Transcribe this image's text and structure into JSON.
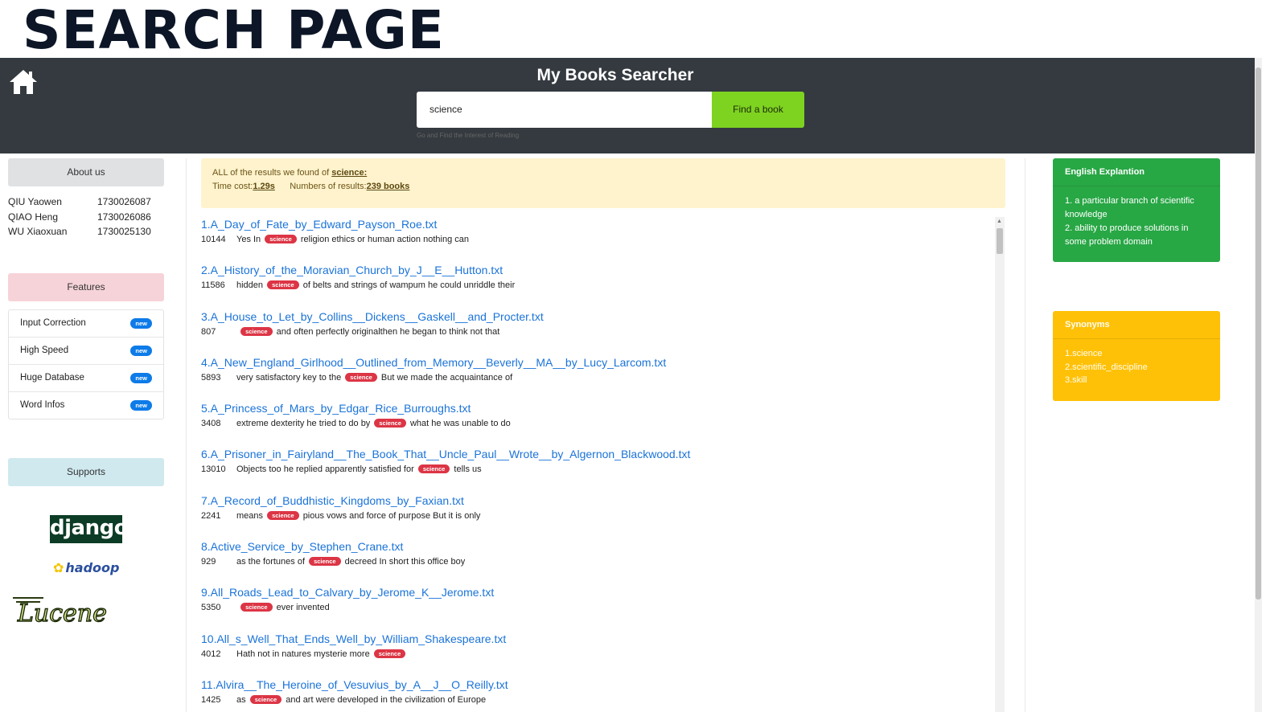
{
  "page_heading": "SEARCH PAGE",
  "header": {
    "app_title": "My Books Searcher",
    "search_value": "science",
    "find_button": "Find a book",
    "tagline": "Go and Find the Interest of Reading"
  },
  "sidebar": {
    "about_title": "About us",
    "members": [
      {
        "name": "QIU   Yaowen",
        "id": "1730026087"
      },
      {
        "name": "QIAO Heng",
        "id": "1730026086"
      },
      {
        "name": "WU    Xiaoxuan",
        "id": "1730025130"
      }
    ],
    "features_title": "Features",
    "features": [
      {
        "label": "Input Correction",
        "badge": "new"
      },
      {
        "label": "High  Speed",
        "badge": "new"
      },
      {
        "label": "Huge  Database",
        "badge": "new"
      },
      {
        "label": "Word  Infos",
        "badge": "new"
      }
    ],
    "supports_title": "Supports",
    "logos": {
      "django": "django",
      "hadoop": "hadoop",
      "lucene": "Lucene"
    }
  },
  "summary": {
    "prefix": "ALL of the results we found of",
    "query": "science:",
    "time_label": "Time cost:",
    "time_value": "1.29s",
    "count_label": "Numbers of results:",
    "count_value": "239 books"
  },
  "results": [
    {
      "title": "1.A_Day_of_Fate_by_Edward_Payson_Roe.txt",
      "count": "10144",
      "before": "Yes In",
      "keyword": "science",
      "after": "religion ethics or human action nothing can"
    },
    {
      "title": "2.A_History_of_the_Moravian_Church_by_J__E__Hutton.txt",
      "count": "11586",
      "before": "hidden",
      "keyword": "science",
      "after": "of belts and strings of wampum he could unriddle their"
    },
    {
      "title": "3.A_House_to_Let_by_Collins__Dickens__Gaskell__and_Procter.txt",
      "count": "807",
      "before": "",
      "keyword": "science",
      "after": "and often perfectly originalthen he began to think not that"
    },
    {
      "title": "4.A_New_England_Girlhood__Outlined_from_Memory__Beverly__MA__by_Lucy_Larcom.txt",
      "count": "5893",
      "before": "very satisfactory key to the",
      "keyword": "science",
      "after": "But we made the acquaintance of"
    },
    {
      "title": "5.A_Princess_of_Mars_by_Edgar_Rice_Burroughs.txt",
      "count": "3408",
      "before": "extreme dexterity he tried to do by",
      "keyword": "science",
      "after": "what he was unable to do"
    },
    {
      "title": "6.A_Prisoner_in_Fairyland__The_Book_That__Uncle_Paul__Wrote__by_Algernon_Blackwood.txt",
      "count": "13010",
      "before": "Objects too he replied apparently satisfied for",
      "keyword": "science",
      "after": "tells us"
    },
    {
      "title": "7.A_Record_of_Buddhistic_Kingdoms_by_Faxian.txt",
      "count": "2241",
      "before": "means",
      "keyword": "science",
      "after": "pious vows and force of purpose But it is only"
    },
    {
      "title": "8.Active_Service_by_Stephen_Crane.txt",
      "count": "929",
      "before": "as the fortunes of",
      "keyword": "science",
      "after": "decreed In short this office boy"
    },
    {
      "title": "9.All_Roads_Lead_to_Calvary_by_Jerome_K__Jerome.txt",
      "count": "5350",
      "before": "",
      "keyword": "science",
      "after": "ever invented"
    },
    {
      "title": "10.All_s_Well_That_Ends_Well_by_William_Shakespeare.txt",
      "count": "4012",
      "before": "Hath not in natures mysterie more",
      "keyword": "science",
      "after": ""
    },
    {
      "title": "11.Alvira__The_Heroine_of_Vesuvius_by_A__J__O_Reilly.txt",
      "count": "1425",
      "before": "as",
      "keyword": "science",
      "after": "and art were developed in the civilization of Europe"
    }
  ],
  "explanation": {
    "title": "English Explantion",
    "lines": [
      "1. a particular branch of scientific knowledge",
      "2. ability to produce solutions in some problem domain"
    ]
  },
  "synonyms": {
    "title": "Synonyms",
    "lines": [
      "1.science",
      "2.scientific_discipline",
      "3.skill"
    ]
  },
  "colors": {
    "header_bg": "#343a40",
    "find_button": "#7ed321",
    "keyword_pill": "#dc3545",
    "link": "#1a73d9",
    "explanation_card": "#28a745",
    "synonyms_card": "#ffc107"
  }
}
